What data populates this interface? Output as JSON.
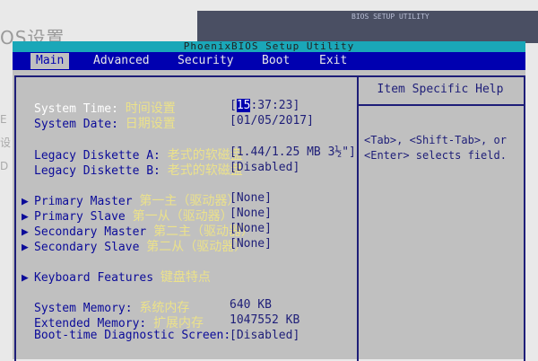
{
  "background": {
    "left_text": "OS设置",
    "dark_title": "BIOS SETUP UTILITY",
    "side_chars": [
      "E",
      "设",
      "D"
    ]
  },
  "bios": {
    "title": "PhoenixBIOS Setup Utility",
    "menu": [
      {
        "label": "Main",
        "active": true
      },
      {
        "label": "Advanced"
      },
      {
        "label": "Security"
      },
      {
        "label": "Boot"
      },
      {
        "label": "Exit"
      }
    ],
    "help": {
      "title": "Item Specific Help",
      "text1": "<Tab>, <Shift-Tab>, or",
      "text2": "<Enter> selects field."
    },
    "rows": {
      "time": {
        "label": "System Time:",
        "cn": "时间设置",
        "value_hour": "15",
        "value_rest": ":37:23]",
        "value_prefix": "["
      },
      "date": {
        "label": "System Date:",
        "cn": "日期设置",
        "value": "[01/05/2017]"
      },
      "dia": {
        "label": "Legacy Diskette A:",
        "cn": "老式的软磁盘",
        "value": "[1.44/1.25 MB  3½\"]"
      },
      "dib": {
        "label": "Legacy Diskette B:",
        "cn": "老式的软磁盘",
        "value": "[Disabled]"
      },
      "pm": {
        "label": "Primary Master",
        "cn": "第一主（驱动器）",
        "value": "[None]"
      },
      "ps": {
        "label": "Primary Slave",
        "cn": "第一从（驱动器）",
        "value": "[None]"
      },
      "sm": {
        "label": "Secondary Master",
        "cn": "第二主（驱动器）",
        "value": "[None]"
      },
      "ss": {
        "label": "Secondary Slave",
        "cn": "第二从（驱动器）",
        "value": "[None]"
      },
      "kb": {
        "label": "Keyboard Features",
        "cn": "键盘特点"
      },
      "sysmem": {
        "label": "System Memory:",
        "cn": "系统内存",
        "value": "640 KB"
      },
      "extmem": {
        "label": "Extended Memory:",
        "cn": "扩展内存",
        "value": "1047552 KB"
      },
      "boot": {
        "label": "Boot-time Diagnostic Screen:",
        "value": "[Disabled]"
      }
    },
    "arrow_char": "▶"
  }
}
